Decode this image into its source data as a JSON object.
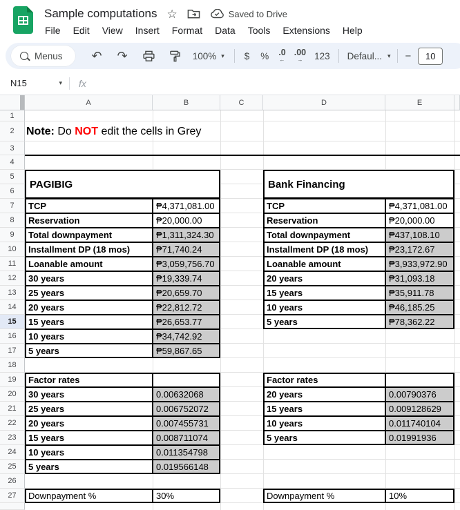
{
  "header": {
    "title": "Sample computations",
    "saved_status": "Saved to Drive",
    "menus": [
      "File",
      "Edit",
      "View",
      "Insert",
      "Format",
      "Data",
      "Tools",
      "Extensions",
      "Help"
    ]
  },
  "toolbar": {
    "menus_label": "Menus",
    "zoom": "100%",
    "currency": "$",
    "percent": "%",
    "decimal_decrease": ".0",
    "decimal_increase": ".00",
    "more_formats": "123",
    "style_name": "Defaul...",
    "font_decrease": "−",
    "font_size": "10"
  },
  "formula_bar": {
    "name_box": "N15",
    "fx": "fx"
  },
  "spreadsheet": {
    "columns": [
      "A",
      "B",
      "C",
      "D",
      "E"
    ],
    "row_numbers": [
      "1",
      "2",
      "3",
      "4",
      "5",
      "6",
      "7",
      "8",
      "9",
      "10",
      "11",
      "12",
      "13",
      "14",
      "15",
      "16",
      "17",
      "18",
      "19",
      "20",
      "21",
      "22",
      "23",
      "24",
      "25",
      "26",
      "27"
    ],
    "selected_row": "15",
    "grey_fill_color": "#cccccc",
    "note": {
      "bold": "Note:",
      "text_a": " Do ",
      "alert": "NOT",
      "text_b": " edit the cells in Grey",
      "alert_color": "#ff0000"
    }
  },
  "tables": {
    "pagibig": {
      "title": "PAGIBIG",
      "items": [
        {
          "label": "TCP",
          "value": "₱4,371,081.00",
          "grey": false
        },
        {
          "label": "Reservation",
          "value": "₱20,000.00",
          "grey": false
        },
        {
          "label": "Total downpayment",
          "value": "₱1,311,324.30",
          "grey": true
        },
        {
          "label": "Installment DP (18 mos)",
          "value": "₱71,740.24",
          "grey": true
        },
        {
          "label": "Loanable amount",
          "value": "₱3,059,756.70",
          "grey": true
        },
        {
          "label": "30 years",
          "value": "₱19,339.74",
          "grey": true
        },
        {
          "label": "25 years",
          "value": "₱20,659.70",
          "grey": true
        },
        {
          "label": "20 years",
          "value": "₱22,812.72",
          "grey": true
        },
        {
          "label": "15 years",
          "value": "₱26,653.77",
          "grey": true
        },
        {
          "label": "10 years",
          "value": "₱34,742.92",
          "grey": true
        },
        {
          "label": "5 years",
          "value": "₱59,867.65",
          "grey": true
        }
      ]
    },
    "bank": {
      "title": "Bank Financing",
      "items": [
        {
          "label": "TCP",
          "value": "₱4,371,081.00",
          "grey": false
        },
        {
          "label": "Reservation",
          "value": "₱20,000.00",
          "grey": false
        },
        {
          "label": "Total downpayment",
          "value": "₱437,108.10",
          "grey": true
        },
        {
          "label": "Installment DP (18 mos)",
          "value": "₱23,172.67",
          "grey": true
        },
        {
          "label": "Loanable amount",
          "value": "₱3,933,972.90",
          "grey": true
        },
        {
          "label": "20 years",
          "value": "₱31,093.18",
          "grey": true
        },
        {
          "label": "15 years",
          "value": "₱35,911.78",
          "grey": true
        },
        {
          "label": "10 years",
          "value": "₱46,185.25",
          "grey": true
        },
        {
          "label": "5 years",
          "value": "₱78,362.22",
          "grey": true
        }
      ]
    },
    "factor_rates_pagibig": {
      "title": "Factor rates",
      "items": [
        {
          "label": "30 years",
          "value": "0.00632068",
          "grey": true
        },
        {
          "label": "25 years",
          "value": "0.006752072",
          "grey": true
        },
        {
          "label": "20 years",
          "value": "0.007455731",
          "grey": true
        },
        {
          "label": "15 years",
          "value": "0.008711074",
          "grey": true
        },
        {
          "label": "10 years",
          "value": "0.011354798",
          "grey": true
        },
        {
          "label": "5 years",
          "value": "0.019566148",
          "grey": true
        }
      ]
    },
    "factor_rates_bank": {
      "title": "Factor rates",
      "items": [
        {
          "label": "20 years",
          "value": "0.00790376",
          "grey": true
        },
        {
          "label": "15 years",
          "value": "0.009128629",
          "grey": true
        },
        {
          "label": "10 years",
          "value": "0.011740104",
          "grey": true
        },
        {
          "label": "5 years",
          "value": "0.01991936",
          "grey": true
        }
      ]
    },
    "downpayment_pagibig": {
      "label": "Downpayment %",
      "value": "30%",
      "grey": false
    },
    "downpayment_bank": {
      "label": "Downpayment %",
      "value": "10%",
      "grey": false
    }
  }
}
